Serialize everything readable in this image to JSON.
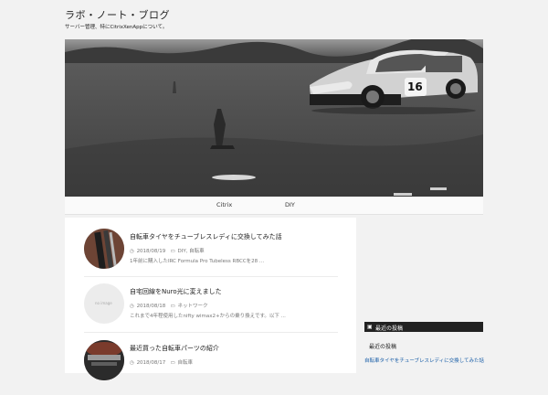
{
  "header": {
    "site_title": "ラボ・ノート・ブログ",
    "site_description": "サーバー管理、特にCitrixXenAppについて。"
  },
  "hero": {
    "car_number": "16"
  },
  "nav": {
    "items": [
      {
        "label": "Citrix"
      },
      {
        "label": "DIY"
      }
    ]
  },
  "posts": [
    {
      "title": "自転車タイヤをチューブレスレディに交換してみた話",
      "date": "2018/08/19",
      "categories": "DIY, 自転車",
      "excerpt": "1年前に購入したIRC Formula Pro Tubeless RBCCを28 ..."
    },
    {
      "title": "自宅回線をNuro光に変えました",
      "date": "2018/08/18",
      "categories": "ネットワーク",
      "excerpt": "これまで4年程使用したnifty wimax2+からの乗り換えです。以下 ...",
      "thumb_label": "no image"
    },
    {
      "title": "最近買った自転車パーツの紹介",
      "date": "2018/08/17",
      "categories": "自転車",
      "excerpt": ""
    }
  ],
  "sidebar": {
    "widget_title": "最近の投稿",
    "widget_subtitle": "最近の投稿",
    "link_text": "自転車タイヤをチューブレスレディに交換してみた話"
  }
}
